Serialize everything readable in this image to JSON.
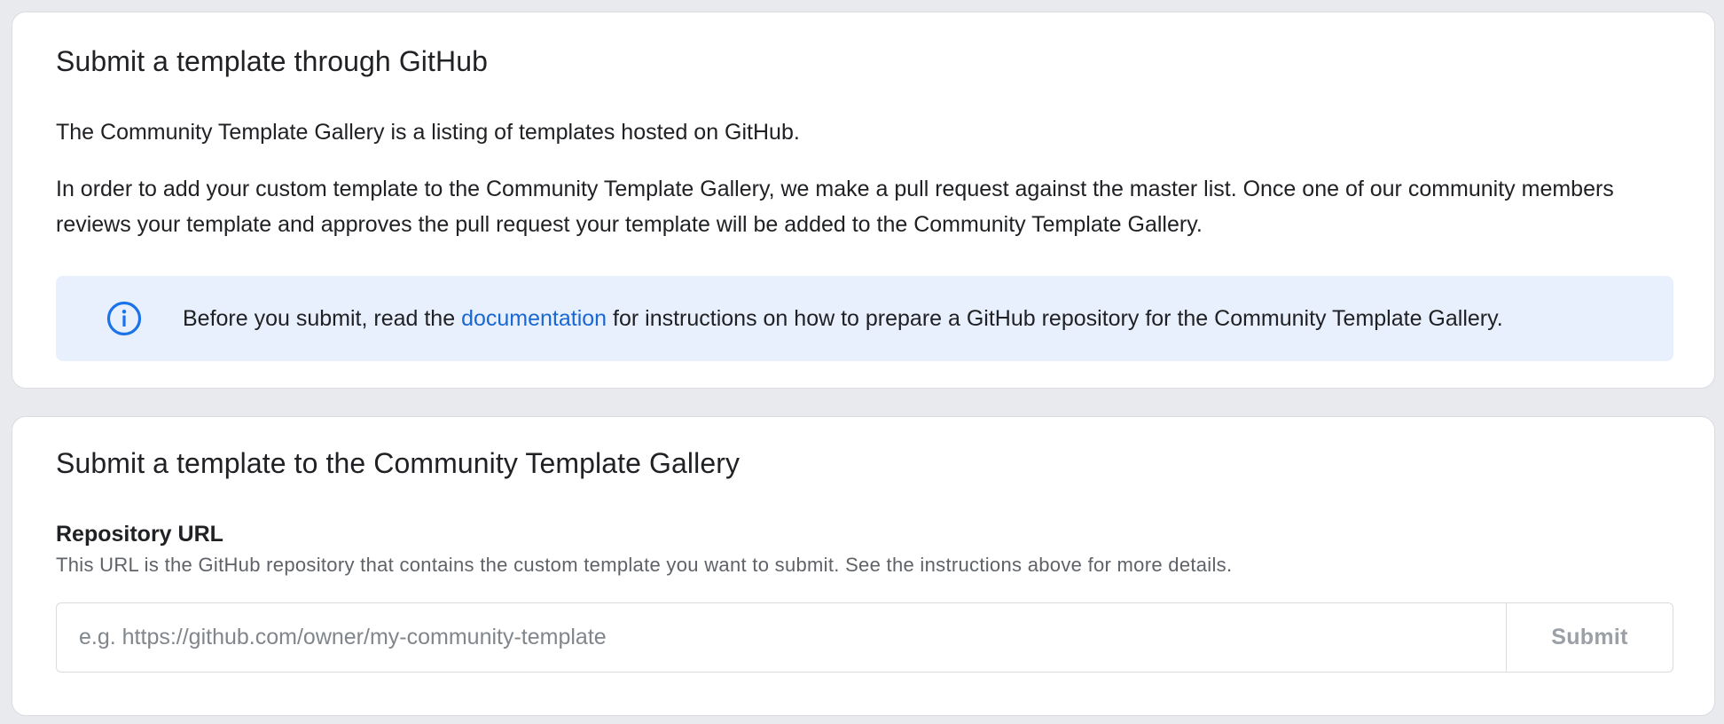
{
  "github_card": {
    "title": "Submit a template through GitHub",
    "paragraph_1": "The Community Template Gallery is a listing of templates hosted on GitHub.",
    "paragraph_2": "In order to add your custom template to the Community Template Gallery, we make a pull request against the master list. Once one of our community members reviews your template and approves the pull request your template will be added to the Community Template Gallery.",
    "banner": {
      "icon": "info-icon",
      "text_before": "Before you submit, read the ",
      "link_text": "documentation",
      "text_after": " for instructions on how to prepare a GitHub repository for the Community Template Gallery."
    }
  },
  "submit_card": {
    "title": "Submit a template to the Community Template Gallery",
    "field_label": "Repository URL",
    "field_help": "This URL is the GitHub repository that contains the custom template you want to submit. See the instructions above for more details.",
    "input_value": "",
    "input_placeholder": "e.g. https://github.com/owner/my-community-template",
    "submit_label": "Submit"
  },
  "colors": {
    "page_background": "#e8eaed",
    "banner_background": "#e8f0fe",
    "link": "#1967d2",
    "icon": "#1a73e8",
    "disabled_button_text": "#9aa0a6"
  }
}
